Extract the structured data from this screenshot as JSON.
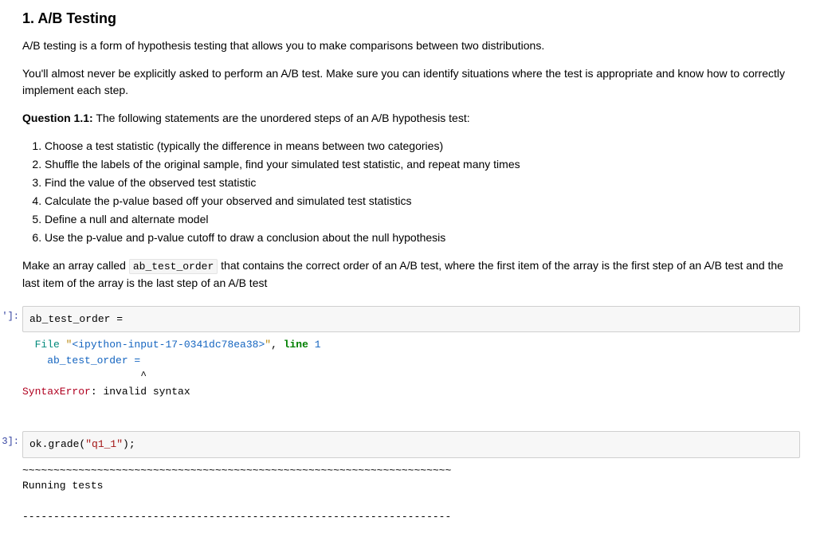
{
  "heading": "1. A/B Testing",
  "intro_p1": "A/B testing is a form of hypothesis testing that allows you to make comparisons between two distributions.",
  "intro_p2": "You'll almost never be explicitly asked to perform an A/B test. Make sure you can identify situations where the test is appropriate and know how to correctly implement each step.",
  "question_label": "Question 1.1:",
  "question_text": " The following statements are the unordered steps of an A/B hypothesis test:",
  "steps": {
    "s1": "Choose a test statistic (typically the difference in means between two categories)",
    "s2": "Shuffle the labels of the original sample, find your simulated test statistic, and repeat many times",
    "s3": "Find the value of the observed test statistic",
    "s4": "Calculate the p-value based off your observed and simulated test statistics",
    "s5": "Define a null and alternate model",
    "s6": "Use the p-value and p-value cutoff to draw a conclusion about the null hypothesis"
  },
  "instr_pre": "Make an array called ",
  "instr_code": "ab_test_order",
  "instr_post": " that contains the correct order of an A/B test, where the first item of the array is the first step of an A/B test and the last item of the array is the last step of an A/B test",
  "cell1": {
    "prompt": "']:",
    "input": "ab_test_order =",
    "out_file_kw": "  File ",
    "out_file_q1": "\"",
    "out_file_name": "<ipython-input-17-0341dc78ea38>",
    "out_file_q2": "\"",
    "out_file_sep": ", ",
    "out_line_kw": "line ",
    "out_line_no": "1",
    "out_echo": "    ab_test_order =",
    "out_caret": "                   ^",
    "out_err_label": "SyntaxError",
    "out_err_sep": ": ",
    "out_err_msg": "invalid syntax"
  },
  "cell2": {
    "prompt": "3]:",
    "input_pre": "ok.grade(",
    "input_str": "\"q1_1\"",
    "input_post": ");",
    "out_rule": "~~~~~~~~~~~~~~~~~~~~~~~~~~~~~~~~~~~~~~~~~~~~~~~~~~~~~~~~~~~~~~~~~~~~~",
    "out_running": "Running tests",
    "out_rule2": "---------------------------------------------------------------------"
  }
}
